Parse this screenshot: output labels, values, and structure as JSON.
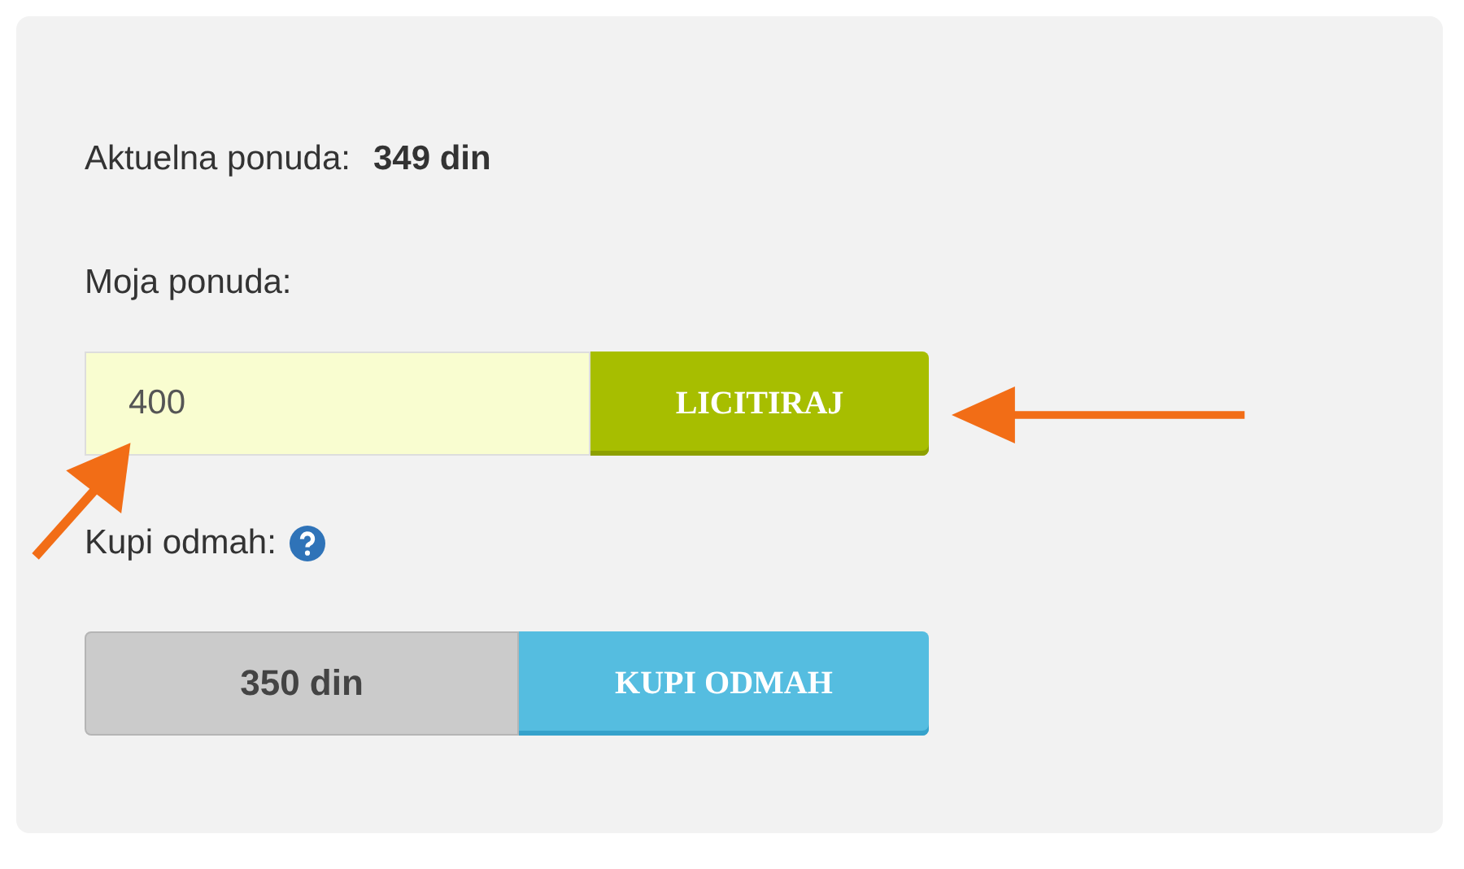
{
  "current_bid": {
    "label": "Aktuelna ponuda:",
    "value": "349 din"
  },
  "my_bid": {
    "label": "Moja ponuda:",
    "value": "400",
    "button": "LICITIRAJ"
  },
  "buy_now": {
    "label": "Kupi odmah:",
    "price": "350 din",
    "button": "KUPI ODMAH"
  }
}
